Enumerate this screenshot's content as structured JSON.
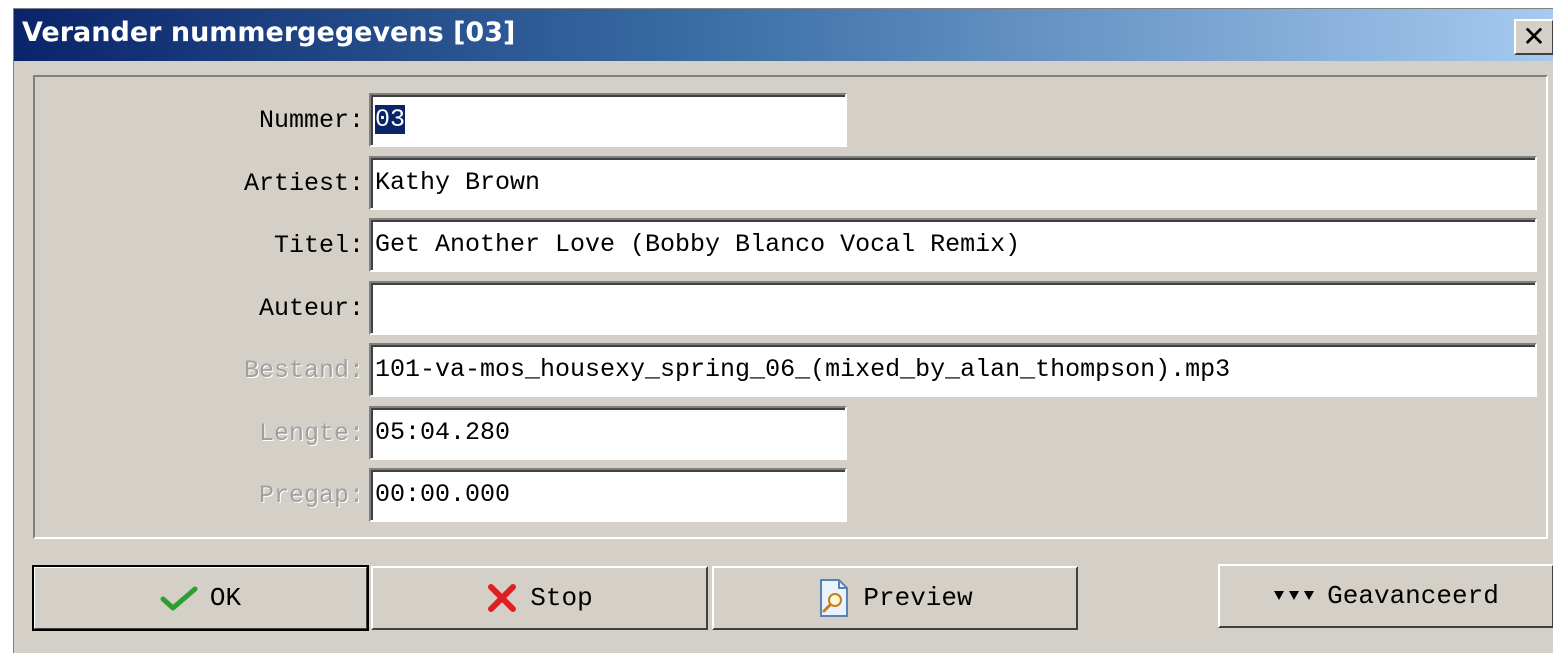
{
  "window": {
    "title": "Verander nummergegevens [03]",
    "close_label": "✕"
  },
  "fields": {
    "nummer": {
      "label": "Nummer:",
      "value": "03",
      "selected": true
    },
    "artiest": {
      "label": "Artiest:",
      "value": "Kathy Brown"
    },
    "titel": {
      "label": "Titel:",
      "value": "Get Another Love (Bobby Blanco Vocal Remix)"
    },
    "auteur": {
      "label": "Auteur:",
      "value": ""
    },
    "bestand": {
      "label": "Bestand:",
      "value": "101-va-mos_housexy_spring_06_(mixed_by_alan_thompson).mp3",
      "disabled": true
    },
    "lengte": {
      "label": "Lengte:",
      "value": "05:04.280",
      "disabled": true
    },
    "pregap": {
      "label": "Pregap:",
      "value": "00:00.000",
      "disabled": true
    }
  },
  "buttons": {
    "ok": {
      "label": "OK",
      "icon": "checkmark-icon",
      "color": "#2e9e2e"
    },
    "stop": {
      "label": "Stop",
      "icon": "red-x-icon",
      "color": "#e02020"
    },
    "preview": {
      "label": "Preview",
      "icon": "document-magnifier-icon"
    },
    "advanced": {
      "label": "Geavanceerd",
      "icon": "triple-down-arrow-icon"
    }
  },
  "colors": {
    "window_bg": "#d4d0c8",
    "title_start": "#0a246a",
    "title_end": "#a6caf0",
    "selection": "#0a246a"
  }
}
